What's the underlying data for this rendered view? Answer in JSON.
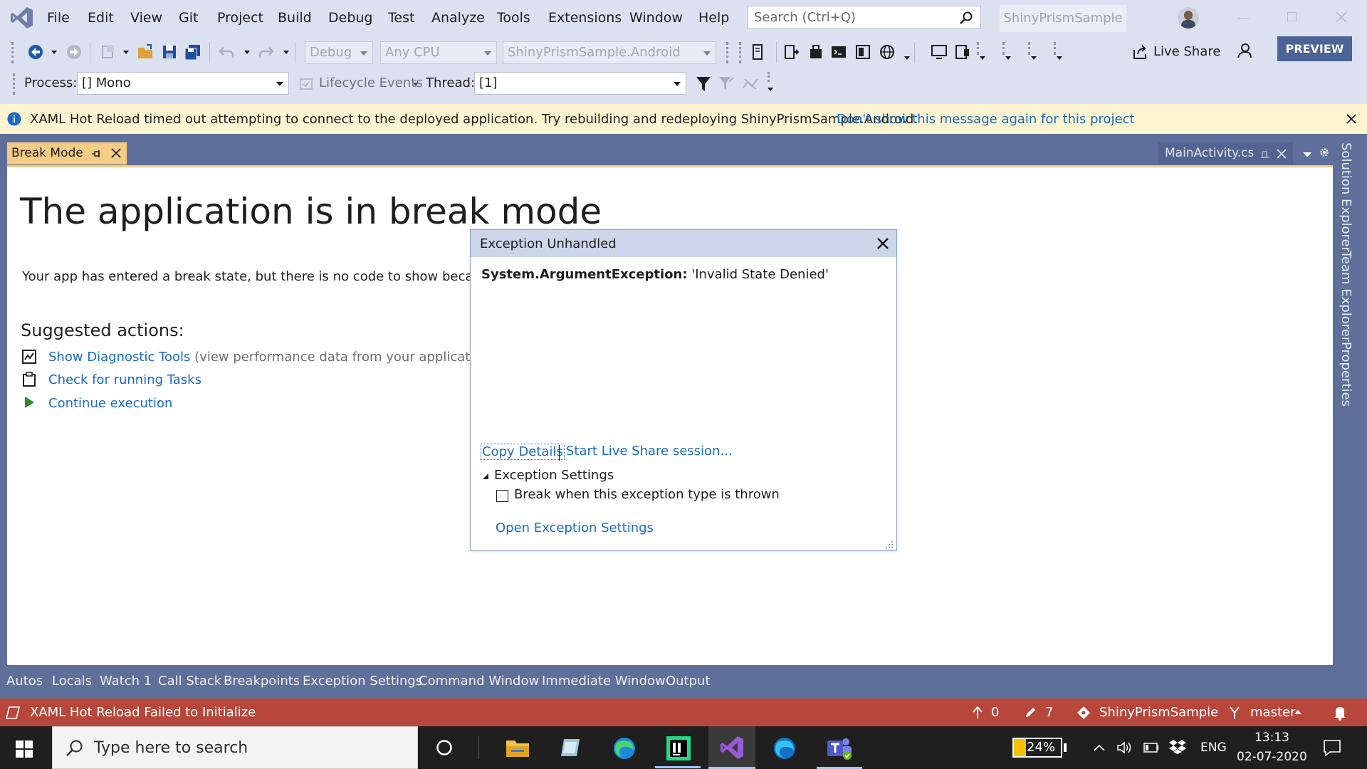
{
  "menu": {
    "items": [
      "File",
      "Edit",
      "View",
      "Git",
      "Project",
      "Build",
      "Debug",
      "Test",
      "Analyze",
      "Tools",
      "Extensions",
      "Window",
      "Help"
    ],
    "search_placeholder": "Search (Ctrl+Q)",
    "solution_name": "ShinyPrismSample"
  },
  "toolbar": {
    "config": "Debug",
    "platform": "Any CPU",
    "startup_project": "ShinyPrismSample.Android",
    "live_share": "Live Share",
    "preview": "PREVIEW",
    "process_label": "Process:",
    "process_value": "[] Mono",
    "lifecycle_events": "Lifecycle Events",
    "thread_label": "Thread:",
    "thread_value": "[1]"
  },
  "infobar": {
    "message": "XAML Hot Reload timed out attempting to connect to the deployed application. Try rebuilding and redeploying ShinyPrismSample.Android.",
    "link": "Don't show this message again for this project"
  },
  "tabs": {
    "active": "Break Mode",
    "other": "MainActivity.cs"
  },
  "side_tabs": [
    "Solution Explorer",
    "Team Explorer",
    "Properties"
  ],
  "break_mode": {
    "title": "The application is in break mode",
    "description": "Your app has entered a break state, but there is no code to show because all thr",
    "suggested_heading": "Suggested actions:",
    "actions": [
      {
        "label": "Show Diagnostic Tools",
        "note": "(view performance data from your application)"
      },
      {
        "label": "Check for running Tasks",
        "note": ""
      },
      {
        "label": "Continue execution",
        "note": ""
      }
    ]
  },
  "exception": {
    "title": "Exception Unhandled",
    "type": "System.ArgumentException:",
    "message": " 'Invalid State Denied'",
    "copy_details": "Copy Details",
    "live_share": "Start Live Share session...",
    "settings_heading": "Exception Settings",
    "checkbox_label": "Break when this exception type is thrown",
    "open_settings": "Open Exception Settings"
  },
  "tool_tabs": [
    "Autos",
    "Locals",
    "Watch 1",
    "Call Stack",
    "Breakpoints",
    "Exception Settings",
    "Command Window",
    "Immediate Window",
    "Output"
  ],
  "status": {
    "message": "XAML Hot Reload Failed to Initialize",
    "up_count": "0",
    "pencil_count": "7",
    "repo": "ShinyPrismSample",
    "branch": "master"
  },
  "taskbar": {
    "search_placeholder": "Type here to search",
    "battery": "24%",
    "language": "ENG",
    "time": "13:13",
    "date": "02-07-2020"
  },
  "colors": {
    "accent_tab": "#f5cc84",
    "status_bar": "#b8473b",
    "link": "#1a6bc4",
    "chrome": "#dbe1f0",
    "docwell": "#5e6f9a"
  }
}
